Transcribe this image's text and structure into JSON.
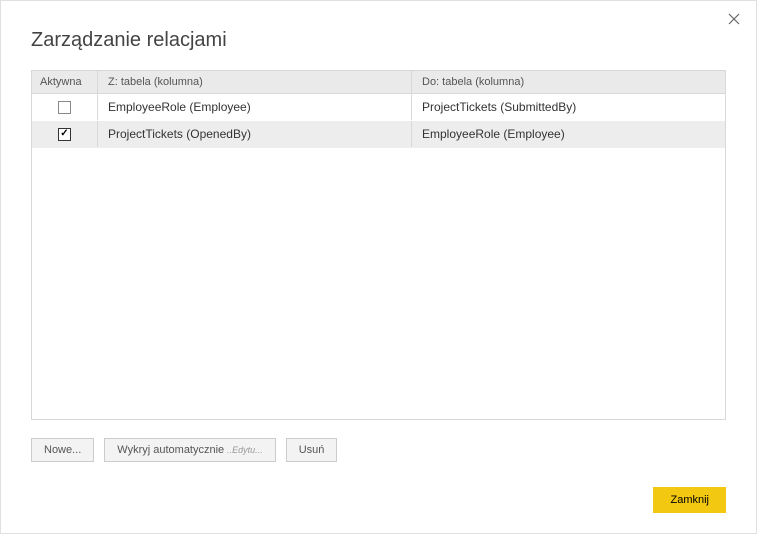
{
  "dialog": {
    "title": "Zarządzanie relacjami"
  },
  "table": {
    "headers": {
      "active": "Aktywna",
      "from": "Z: tabela (kolumna)",
      "to": "Do: tabela (kolumna)"
    },
    "rows": [
      {
        "active": false,
        "from": "EmployeeRole (Employee)",
        "to": "ProjectTickets (SubmittedBy)"
      },
      {
        "active": true,
        "from": "ProjectTickets (OpenedBy)",
        "to": "EmployeeRole (Employee)"
      }
    ]
  },
  "buttons": {
    "new": "Nowe...",
    "autodetect": "Wykryj automatycznie",
    "autodetect_sub": "..Edytu...",
    "delete": "Usuń",
    "close": "Zamknij"
  }
}
